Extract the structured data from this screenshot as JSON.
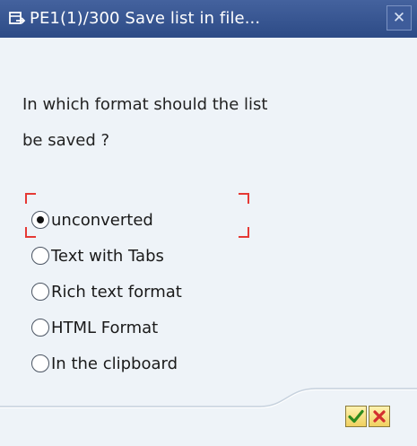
{
  "window": {
    "title": "PE1(1)/300 Save list in file...",
    "close_glyph": "✕",
    "icon": "save-list-icon"
  },
  "question": {
    "line1": "In which format should the list",
    "line2": "be saved ?"
  },
  "options": [
    {
      "label": "unconverted",
      "selected": true
    },
    {
      "label": "Text with Tabs",
      "selected": false
    },
    {
      "label": "Rich text format",
      "selected": false
    },
    {
      "label": "HTML Format",
      "selected": false
    },
    {
      "label": "In the clipboard",
      "selected": false
    }
  ],
  "buttons": {
    "ok_icon": "checkmark-icon",
    "cancel_icon": "cross-icon"
  },
  "colors": {
    "titlebar": "#2d4b86",
    "background": "#eef3f8",
    "focus": "#e53935",
    "ok": "#2e8b1e",
    "cancel": "#d32f2f"
  }
}
